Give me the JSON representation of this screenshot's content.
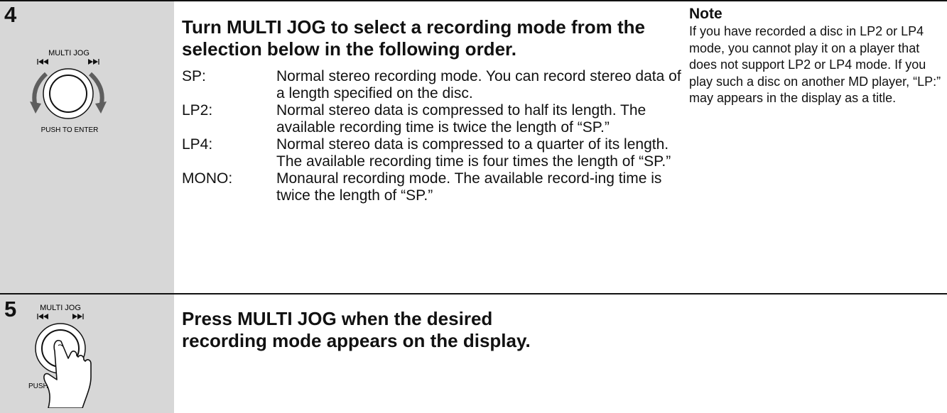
{
  "steps": [
    {
      "number": "4",
      "illustration": {
        "knob_label": "MULTI JOG",
        "push_label": "PUSH TO ENTER",
        "prev_icon": "skip-previous-icon",
        "next_icon": "skip-next-icon",
        "motion": "rotate-arrows"
      },
      "heading": "Turn MULTI JOG to select a recording mode from the selection below in the following order.",
      "modes": [
        {
          "name": "SP:",
          "description": "Normal stereo recording mode. You can record stereo data of a length specified on the disc."
        },
        {
          "name": "LP2:",
          "description": "Normal stereo data is compressed to half its length. The available recording time is twice the length of “SP.”"
        },
        {
          "name": "LP4:",
          "description": "Normal stereo data is compressed to a quarter of its length. The available recording time is four times the length of “SP.”"
        },
        {
          "name": "MONO:",
          "description": "Monaural recording mode. The available record-ing time is twice the length of “SP.”"
        }
      ],
      "note": {
        "title": "Note",
        "text": "If you have recorded a disc in LP2 or LP4 mode, you cannot play it on a player that does not support LP2 or LP4 mode. If you play such a disc on another MD player, “LP:” may appears in the display as a title."
      }
    },
    {
      "number": "5",
      "illustration": {
        "knob_label": "MULTI JOG",
        "push_label": "PUSH TO",
        "prev_icon": "skip-previous-icon",
        "next_icon": "skip-next-icon",
        "motion": "finger-press"
      },
      "heading": "Press MULTI JOG when the desired recording mode appears on the display."
    }
  ]
}
